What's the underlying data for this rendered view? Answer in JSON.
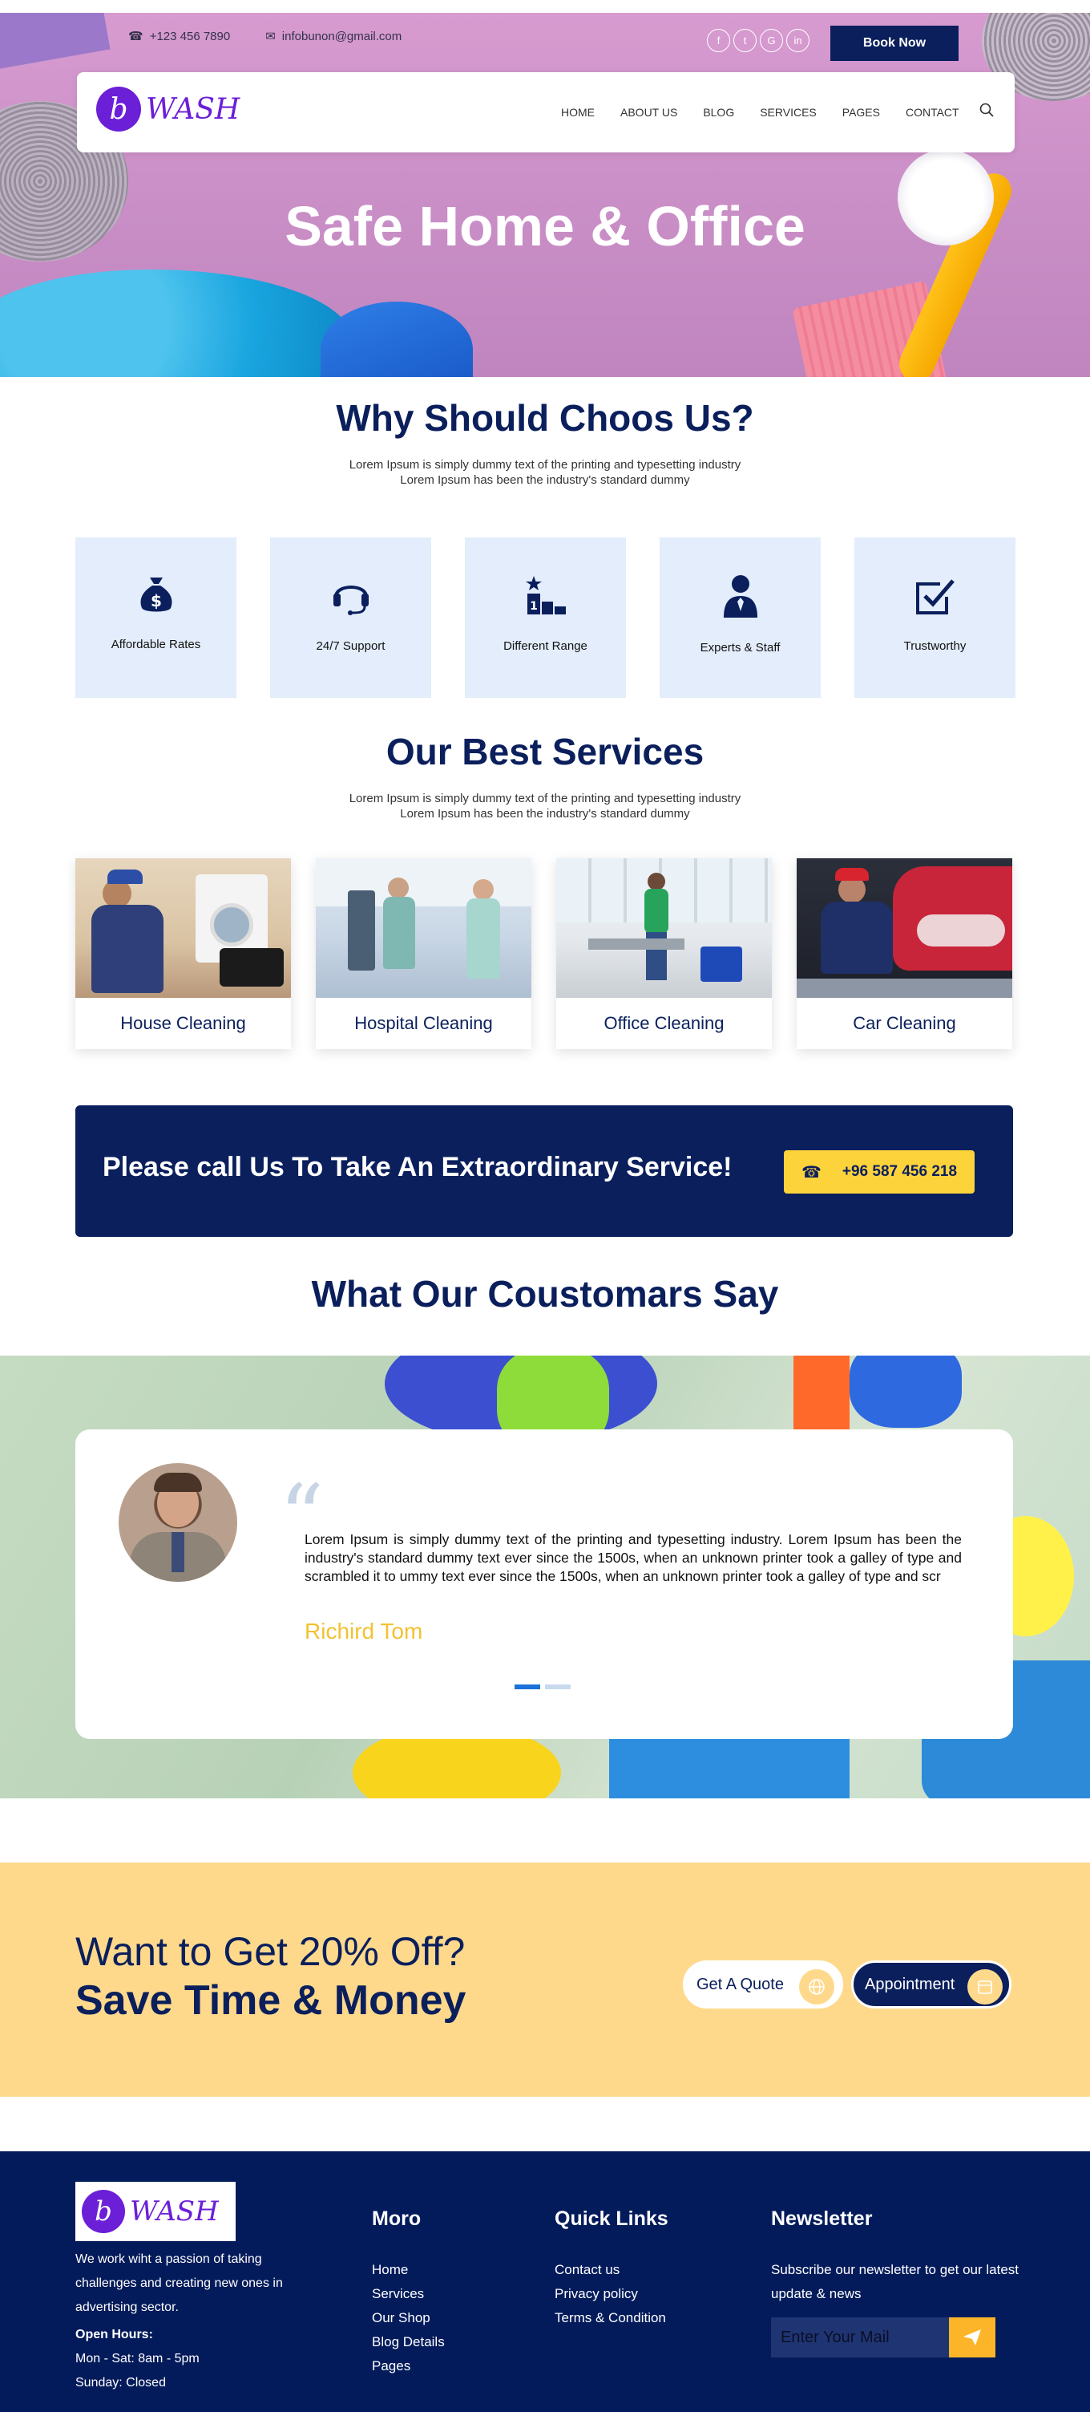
{
  "topbar": {
    "phone": "+123 456 7890",
    "email": "infobunon@gmail.com",
    "socials": [
      "facebook-icon",
      "twitter-icon",
      "google-icon",
      "linkedin-icon"
    ],
    "book_label": "Book Now"
  },
  "nav": {
    "logo_mark": "b",
    "logo_word": "WASH",
    "links": [
      "HOME",
      "ABOUT US",
      "BLOG",
      "SERVICES",
      "PAGES",
      "CONTACT"
    ]
  },
  "hero": {
    "title": "Safe Home & Office"
  },
  "why": {
    "title": "Why Should Choos Us?",
    "sub1": "Lorem Ipsum is simply dummy text of the printing and typesetting industry",
    "sub2": "Lorem Ipsum has been the industry's standard dummy",
    "features": [
      {
        "label": "Affordable Rates",
        "icon": "money-bag-icon"
      },
      {
        "label": "24/7 Support",
        "icon": "headset-icon"
      },
      {
        "label": "Different Range",
        "icon": "podium-icon"
      },
      {
        "label": "Experts & Staff",
        "icon": "staff-icon"
      },
      {
        "label": "Trustworthy",
        "icon": "check-box-icon"
      }
    ]
  },
  "services": {
    "title": "Our Best Services",
    "sub1": "Lorem Ipsum is simply dummy text of the printing and typesetting industry",
    "sub2": "Lorem Ipsum has been the industry's standard dummy",
    "items": [
      "House Cleaning",
      "Hospital Cleaning",
      "Office Cleaning",
      "Car Cleaning"
    ]
  },
  "cta": {
    "text": "Please call Us To Take An Extraordinary Service!",
    "phone": "+96 587 456 218"
  },
  "testimonials": {
    "title": "What Our Coustomars Say",
    "quote": "Lorem Ipsum is simply dummy text of the printing and typesetting industry. Lorem Ipsum has been the industry's standard dummy text ever since the 1500s, when an unknown printer took a galley of type and scrambled it to ummy text ever since the 1500s, when an unknown printer took a galley of type and scr",
    "name": "Richird Tom",
    "slides": 2,
    "active_slide": 1
  },
  "offer": {
    "line1": "Want to Get 20% Off?",
    "line2": "Save Time & Money",
    "quote_label": "Get A Quote",
    "appointment_label": "Appointment"
  },
  "footer": {
    "logo_mark": "b",
    "logo_word": "WASH",
    "about": "We work wiht a passion of taking challenges and creating new ones in advertising sector.",
    "hours_label": "Open Hours:",
    "hours_week": "Mon - Sat: 8am - 5pm",
    "hours_sun": "Sunday: Closed",
    "more_title": "Moro",
    "more_links": [
      "Home",
      "Services",
      "Our Shop",
      "Blog Details",
      "Pages"
    ],
    "quick_title": "Quick Links",
    "quick_links": [
      "Contact us",
      "Privacy policy",
      "Terms & Condition"
    ],
    "news_title": "Newsletter",
    "news_text": "Subscribe our newsletter to get our latest update & news",
    "news_placeholder": "Enter Your Mail"
  },
  "colors": {
    "navy": "#0a1f5c",
    "yellow": "#fcd33a",
    "purple": "#6b1fd6",
    "feature_bg": "#e3edfb",
    "offer_bg": "#ffd98b",
    "footer_bg": "#041b5b"
  }
}
